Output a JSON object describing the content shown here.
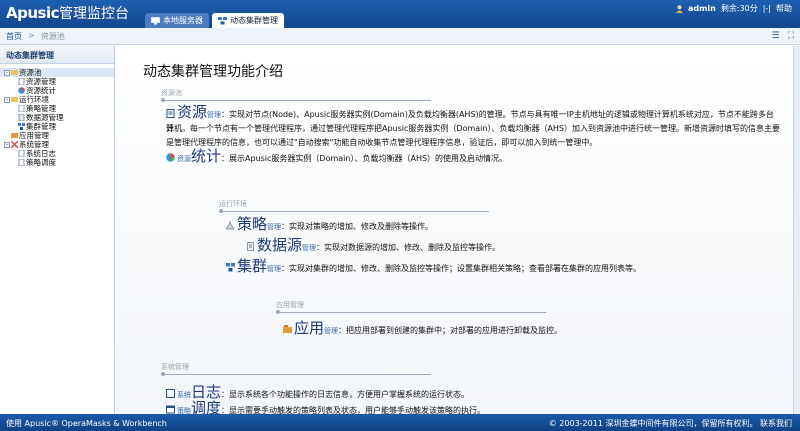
{
  "header": {
    "brand": "Apusic",
    "brand_cn": "管理监控台",
    "tabs": [
      {
        "label": "本地服务器"
      },
      {
        "label": "动态集群管理"
      }
    ],
    "user": "admin",
    "session": "剩余:30分",
    "help": "|-|",
    "help_link": "帮助"
  },
  "breadcrumb": {
    "home": "首页",
    "sep": ">",
    "current": "资源池"
  },
  "sidebar": {
    "title": "动态集群管理",
    "tree": [
      {
        "label": "资源池",
        "level": 0,
        "toggle": "-",
        "icon": "folder-icon"
      },
      {
        "label": "资源管理",
        "level": 1,
        "icon": "page-icon"
      },
      {
        "label": "资源统计",
        "level": 1,
        "icon": "chart-icon"
      },
      {
        "label": "运行环境",
        "level": 0,
        "toggle": "-",
        "icon": "folder-icon"
      },
      {
        "label": "策略管理",
        "level": 1,
        "icon": "page-icon"
      },
      {
        "label": "数据源管理",
        "level": 1,
        "icon": "page-icon"
      },
      {
        "label": "集群管理",
        "level": 1,
        "icon": "cluster-icon"
      },
      {
        "label": "应用管理",
        "level": 0,
        "toggle": "",
        "icon": "app-icon"
      },
      {
        "label": "系统管理",
        "level": 0,
        "toggle": "-",
        "icon": "folder-icon"
      },
      {
        "label": "系统日志",
        "level": 1,
        "icon": "page-icon"
      },
      {
        "label": "策略调度",
        "level": 1,
        "icon": "page-icon"
      }
    ]
  },
  "main": {
    "title": "动态集群管理功能介绍",
    "sections": {
      "pool": "资源池",
      "env": "运行环境",
      "app": "应用管理",
      "sys": "系统管理"
    },
    "entries": {
      "resource_big": "资源",
      "resource_small": "管理",
      "resource_desc1": "：实现对节点(Node)、Apusic服务器实例(Domain)及负载均衡器(AHS)的管理。节点与具有唯一IP主机地址的逻辑或物理计算机系统对应，节点不能跨多台计",
      "resource_desc2": "算机。每一个节点有一个管理代理程序，通过管理代理程序把Apusic服务器实例（Domain）、负载均衡器（AHS）加入到资源池中进行统一管理。新增资源时填写的信息主要",
      "resource_desc3": "是管理代理程序的信息，也可以通过\"自动搜索\"功能自动收集节点管理代理程序信息，验证后，即可以加入到统一管理中。",
      "stats_small": "资源",
      "stats_big": "统计",
      "stats_desc": "：展示Apusic服务器实例（Domain）、负载均衡器（AHS）的使用及启动情况。",
      "policy_big": "策略",
      "policy_small": "管理",
      "policy_desc": "：实现对策略的增加、修改及删除等操作。",
      "ds_big": "数据源",
      "ds_small": "管理",
      "ds_desc": "：实现对数据源的增加、修改、删除及监控等操作。",
      "cluster_big": "集群",
      "cluster_small": "管理",
      "cluster_desc": "：实现对集群的增加、修改、删除及监控等操作；设置集群相关策略；查看部署在集群的应用列表等。",
      "app_big": "应用",
      "app_small": "管理",
      "app_desc": "：把应用部署到创建的集群中；对部署的应用进行卸载及监控。",
      "log_small": "系统",
      "log_big": "日志",
      "log_desc": "：显示系统各个功能操作的日志信息，方便用户掌握系统的运行状态。",
      "sched_small": "策略",
      "sched_big": "调度",
      "sched_desc": "：显示需要手动触发的策略列表及状态，用户能够手动触发该策略的执行。"
    }
  },
  "footer": {
    "left": "使用 Apusic® OperaMasks & Workbench",
    "right": "© 2003-2011 深圳金蝶中间件有限公司，保留所有权利。 联系我们"
  },
  "colors": {
    "header": "#1a55a3",
    "accent": "#1d3a7a",
    "footer": "#1550a0"
  }
}
